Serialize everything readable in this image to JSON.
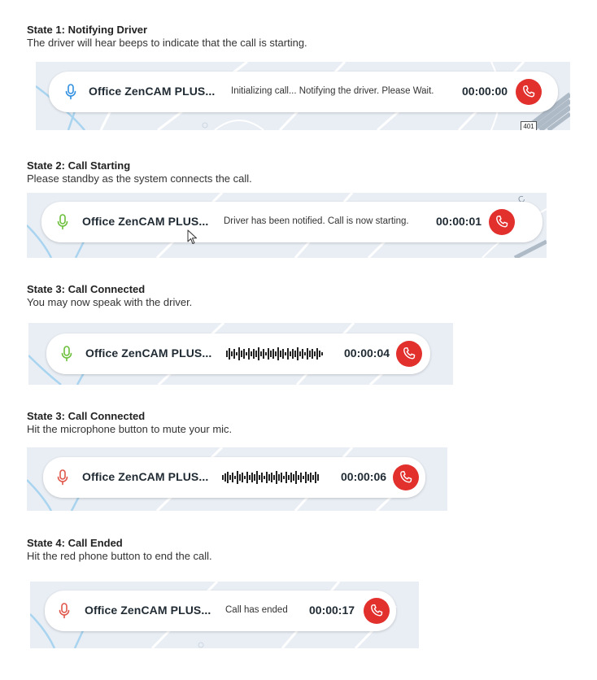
{
  "caller_name": "Office ZenCAM PLUS...",
  "colors": {
    "mic_blue": "#2f8fe0",
    "mic_green": "#6bbf3a",
    "mic_red": "#e0564a",
    "end_call_red": "#e2302d",
    "map_bg": "#e9eef5"
  },
  "states": [
    {
      "title": "State 1: Notifying Driver",
      "description": "The driver will hear beeps to indicate that the call is starting.",
      "status": "Initializing call... Notifying the driver. Please Wait.",
      "timer": "00:00:00",
      "mic_icon": "microphone-icon",
      "map_label": "401"
    },
    {
      "title": "State 2: Call Starting",
      "description": "Please standby as the system connects the call.",
      "status": "Driver has been notified. Call is now starting.",
      "timer": "00:00:01",
      "mic_icon": "microphone-icon"
    },
    {
      "title": "State 3: Call Connected",
      "description": "You may now speak with the driver.",
      "timer": "00:00:04",
      "mic_icon": "microphone-icon",
      "status_icon": "audio-waveform-icon"
    },
    {
      "title": "State 3: Call Connected",
      "description": "Hit the microphone button to mute your mic.",
      "timer": "00:00:06",
      "mic_icon": "microphone-icon",
      "status_icon": "audio-waveform-icon"
    },
    {
      "title": "State 4: Call Ended",
      "description": "Hit the red phone button to end the call.",
      "status": "Call has ended",
      "timer": "00:00:17",
      "mic_icon": "microphone-icon"
    }
  ]
}
